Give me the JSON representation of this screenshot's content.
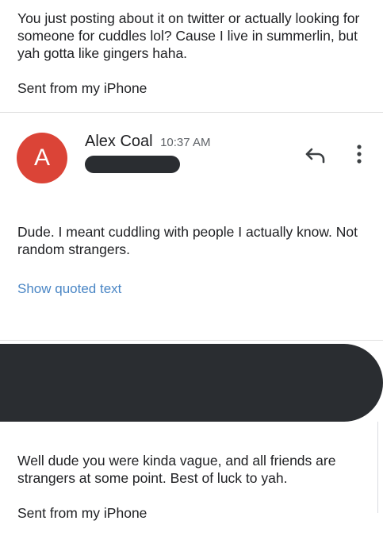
{
  "top_message": {
    "body": "You just posting about it on twitter or actually looking for someone for cuddles lol? Cause I live in summerlin, but yah gotta like gingers haha.",
    "signature": "Sent from my iPhone"
  },
  "email": {
    "avatar_letter": "A",
    "avatar_color": "#db4437",
    "sender_name": "Alex Coal",
    "time": "10:37 AM",
    "actions": {
      "reply_icon": "reply-arrow",
      "more_icon": "vertical-dots"
    },
    "body": "Dude. I meant cuddling with people I actually know. Not random strangers.",
    "show_quoted_label": "Show quoted text",
    "link_color": "#4a86c5"
  },
  "bottom_message": {
    "body": "Well dude you were kinda vague, and all friends are strangers at some point. Best of luck to yah.",
    "signature": "Sent from my iPhone"
  }
}
